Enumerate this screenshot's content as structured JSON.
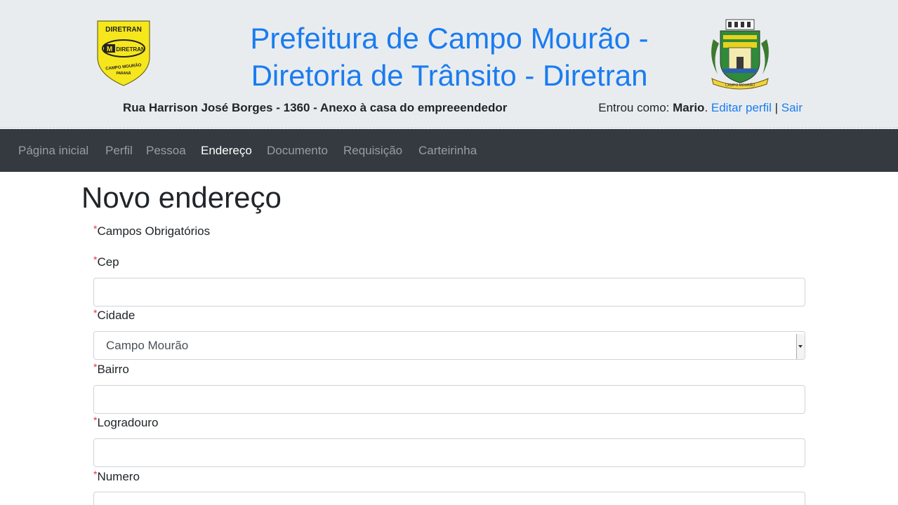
{
  "header": {
    "title": "Prefeitura de Campo Mourão - Diretoria de Trânsito - Diretran",
    "address": "Rua Harrison José Borges - 1360 - Anexo à casa do empreeendedor",
    "logged_as_label": "Entrou como: ",
    "user_name": "Mario",
    "edit_profile_link": "Editar perfil",
    "separator": "|",
    "logout_link": "Sair",
    "left_logo": {
      "icon": "diretran-shield-logo",
      "text_top": "DIRETRAN",
      "text_mid": "DIRETRAN",
      "text_bottom": "CAMPO MOURÃO",
      "text_state": "PARANÁ"
    },
    "right_logo": {
      "icon": "city-coat-of-arms"
    }
  },
  "nav": {
    "items": [
      {
        "label": "Página inicial",
        "active": false
      },
      {
        "label": "Perfil",
        "active": false
      },
      {
        "label": "Pessoa",
        "active": false
      },
      {
        "label": "Endereço",
        "active": true
      },
      {
        "label": "Documento",
        "active": false
      },
      {
        "label": "Requisição",
        "active": false
      },
      {
        "label": "Carteirinha",
        "active": false
      }
    ]
  },
  "page": {
    "title": "Novo endereço",
    "required_note": "Campos Obrigatórios",
    "required_mark": "*"
  },
  "form": {
    "cep": {
      "label": "Cep",
      "value": ""
    },
    "cidade": {
      "label": "Cidade",
      "value": "Campo Mourão"
    },
    "bairro": {
      "label": "Bairro",
      "value": ""
    },
    "logradouro": {
      "label": "Logradouro",
      "value": ""
    },
    "numero": {
      "label": "Numero",
      "value": ""
    }
  },
  "colors": {
    "link": "#1a7cf0",
    "navbar": "#343a40",
    "header_bg": "#e9ecef",
    "required": "#dc3545"
  }
}
